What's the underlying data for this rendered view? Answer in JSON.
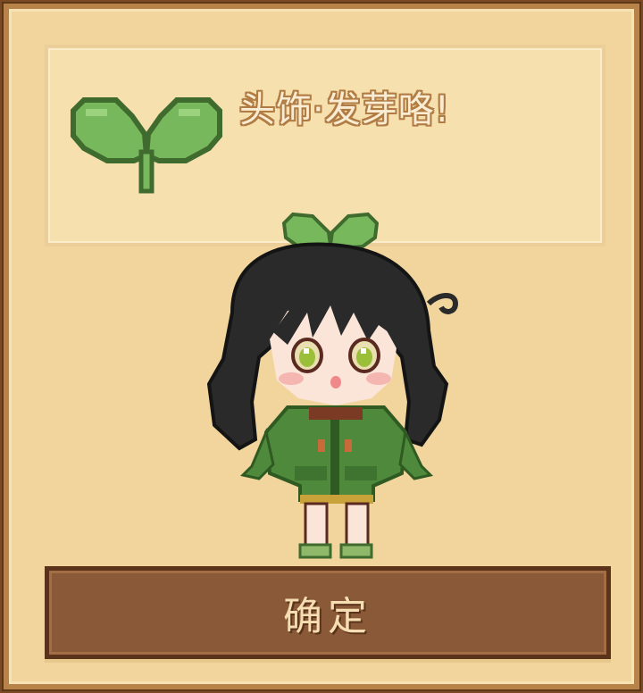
{
  "reward": {
    "item_name": "头饰·发芽咯!",
    "icon": "sprout-icon"
  },
  "character": {
    "icon": "chibi-girl-with-sprout-headwear",
    "hair_color": "#2a2a2a",
    "outfit_color": "#4f8a3c"
  },
  "buttons": {
    "confirm_label": "确定"
  },
  "colors": {
    "panel_bg": "#f1d59c",
    "frame": "#b78348",
    "button_bg": "#8a5a38",
    "sprout_green": "#78b85c"
  }
}
